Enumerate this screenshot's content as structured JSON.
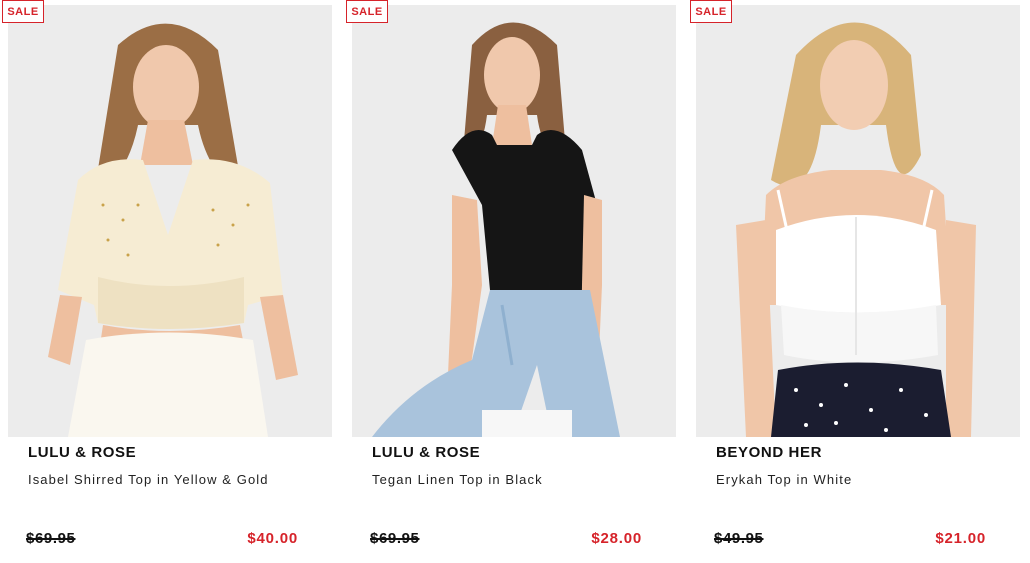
{
  "theme": {
    "sale_red": "#d6232a",
    "photo_bg": "#ececec",
    "text": "#111111"
  },
  "products": [
    {
      "badge": "SALE",
      "brand": "LULU & ROSE",
      "name": "Isabel Shirred Top in Yellow & Gold",
      "was_price": "$69.95",
      "sale_price": "$40.00",
      "image": "model-wearing-cream-shirred-v-neck-top-with-white-skirt"
    },
    {
      "badge": "SALE",
      "brand": "LULU & ROSE",
      "name": "Tegan Linen Top in Black",
      "was_price": "$69.95",
      "sale_price": "$28.00",
      "image": "model-seated-in-black-puff-sleeve-top-and-light-blue-jeans"
    },
    {
      "badge": "SALE",
      "brand": "BEYOND HER",
      "name": "Erykah Top in White",
      "was_price": "$49.95",
      "sale_price": "$21.00",
      "image": "model-in-white-shirred-cami-and-black-floral-skirt"
    }
  ]
}
